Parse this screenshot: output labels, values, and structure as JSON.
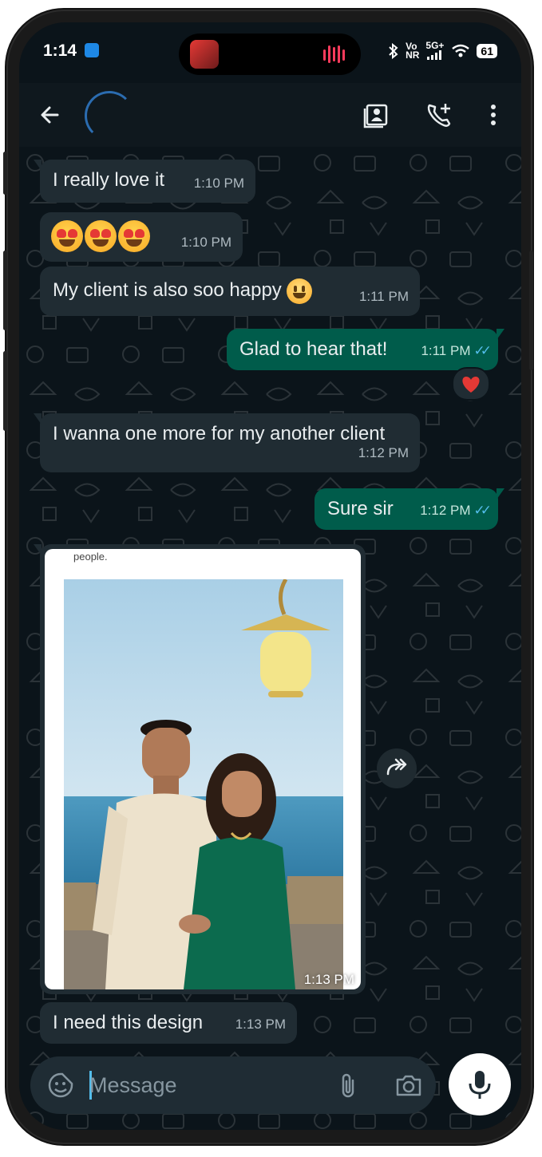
{
  "status_bar": {
    "time": "1:14",
    "network_vo": "Vo",
    "network_nr": "NR",
    "network_5g": "5G+",
    "battery": "61"
  },
  "header": {
    "back_icon": "arrow-left",
    "gallery_icon": "contact-card",
    "call_icon": "phone-add",
    "menu_icon": "more-vertical"
  },
  "messages": [
    {
      "dir": "in",
      "text": "I really love it",
      "time": "1:10 PM"
    },
    {
      "dir": "in",
      "emoji": "heart-eyes x3",
      "time": "1:10 PM"
    },
    {
      "dir": "in",
      "text": "My client is also soo happy",
      "emoji": "grinning-face",
      "time": "1:11 PM"
    },
    {
      "dir": "out",
      "text": "Glad to hear that!",
      "time": "1:11 PM",
      "status": "read",
      "reaction": "red-heart"
    },
    {
      "dir": "in",
      "text": "I wanna one more for my another client",
      "time": "1:12 PM"
    },
    {
      "dir": "out",
      "text": "Sure sir",
      "time": "1:12 PM",
      "status": "read"
    },
    {
      "dir": "in",
      "type": "image",
      "caption_top": "people.",
      "time": "1:13 PM"
    },
    {
      "dir": "in",
      "text": "I need this design",
      "time": "1:13 PM"
    }
  ],
  "input": {
    "placeholder": "Message",
    "sticker_icon": "sticker",
    "attach_icon": "paperclip",
    "camera_icon": "camera",
    "mic_icon": "microphone"
  },
  "colors": {
    "chat_bg": "#0b141a",
    "bubble_in": "#202c33",
    "bubble_out": "#005c4b",
    "read_ticks": "#53bdeb"
  }
}
